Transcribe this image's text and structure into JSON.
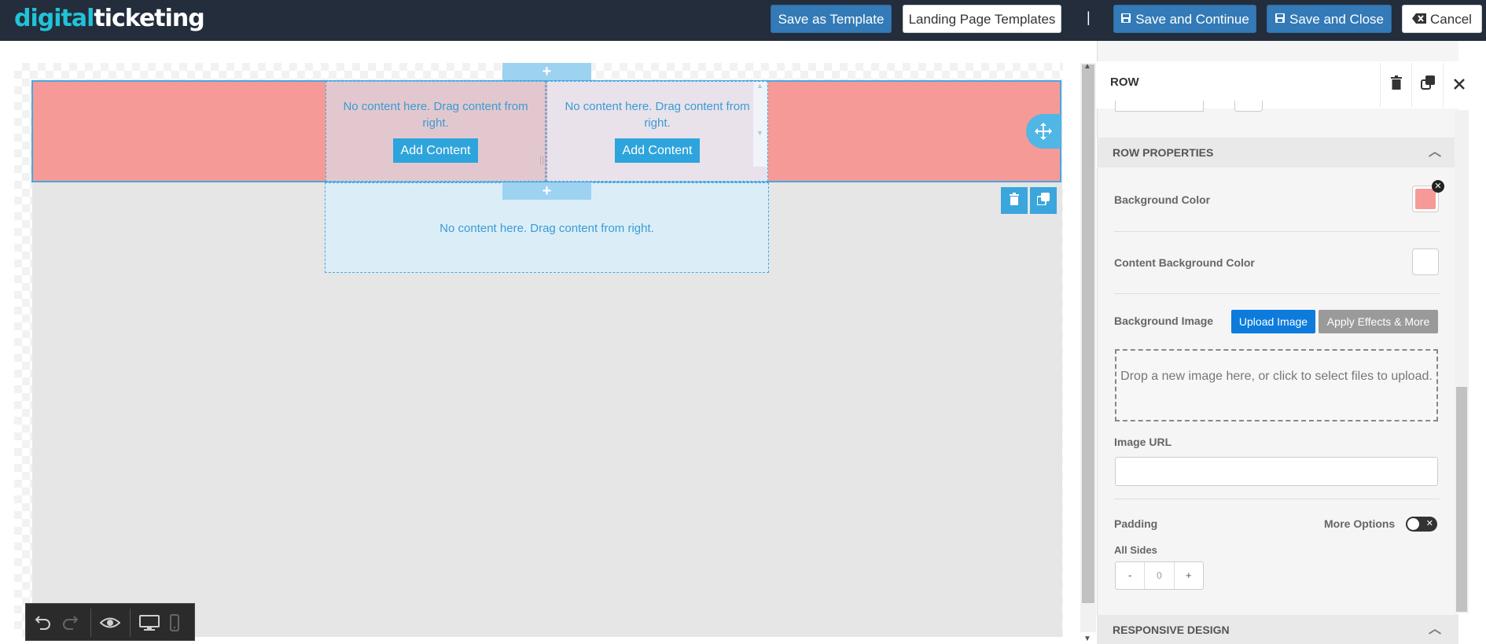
{
  "header": {
    "logo_part1": "digital",
    "logo_part2": "ticketing",
    "save_template_label": "Save as Template",
    "landing_templates_label": "Landing Page Templates",
    "separator": "|",
    "save_continue_label": "Save and Continue",
    "save_close_label": "Save and Close",
    "cancel_label": "Cancel"
  },
  "canvas": {
    "col1_message": "No content here. Drag content from right.",
    "col2_message": "No content here. Drag content from right.",
    "add_content_label": "Add Content",
    "lower_message": "No content here. Drag content from right.",
    "row_background_color": "#f59a97",
    "selection_color": "#4aa8e0"
  },
  "panel": {
    "title": "ROW",
    "row_properties_title": "ROW PROPERTIES",
    "background_color_label": "Background Color",
    "background_color_value": "#f59a97",
    "content_bg_label": "Content Background Color",
    "content_bg_value": "#ffffff",
    "background_image_label": "Background Image",
    "upload_image_label": "Upload Image",
    "apply_effects_label": "Apply Effects & More",
    "dropzone_text": "Drop a new image here, or click to select files to upload.",
    "image_url_label": "Image URL",
    "image_url_value": "",
    "padding_label": "Padding",
    "more_options_label": "More Options",
    "all_sides_label": "All Sides",
    "padding_minus": "-",
    "padding_value": "0",
    "padding_plus": "+",
    "responsive_design_title": "RESPONSIVE DESIGN"
  },
  "icons": {
    "save": "floppy-disk-icon",
    "cancel": "backspace-icon",
    "move": "move-arrows-icon",
    "trash": "trash-icon",
    "duplicate": "duplicate-icon",
    "close": "close-icon",
    "undo": "undo-icon",
    "redo": "redo-icon",
    "preview": "eye-icon",
    "desktop": "desktop-icon",
    "mobile": "mobile-icon"
  }
}
